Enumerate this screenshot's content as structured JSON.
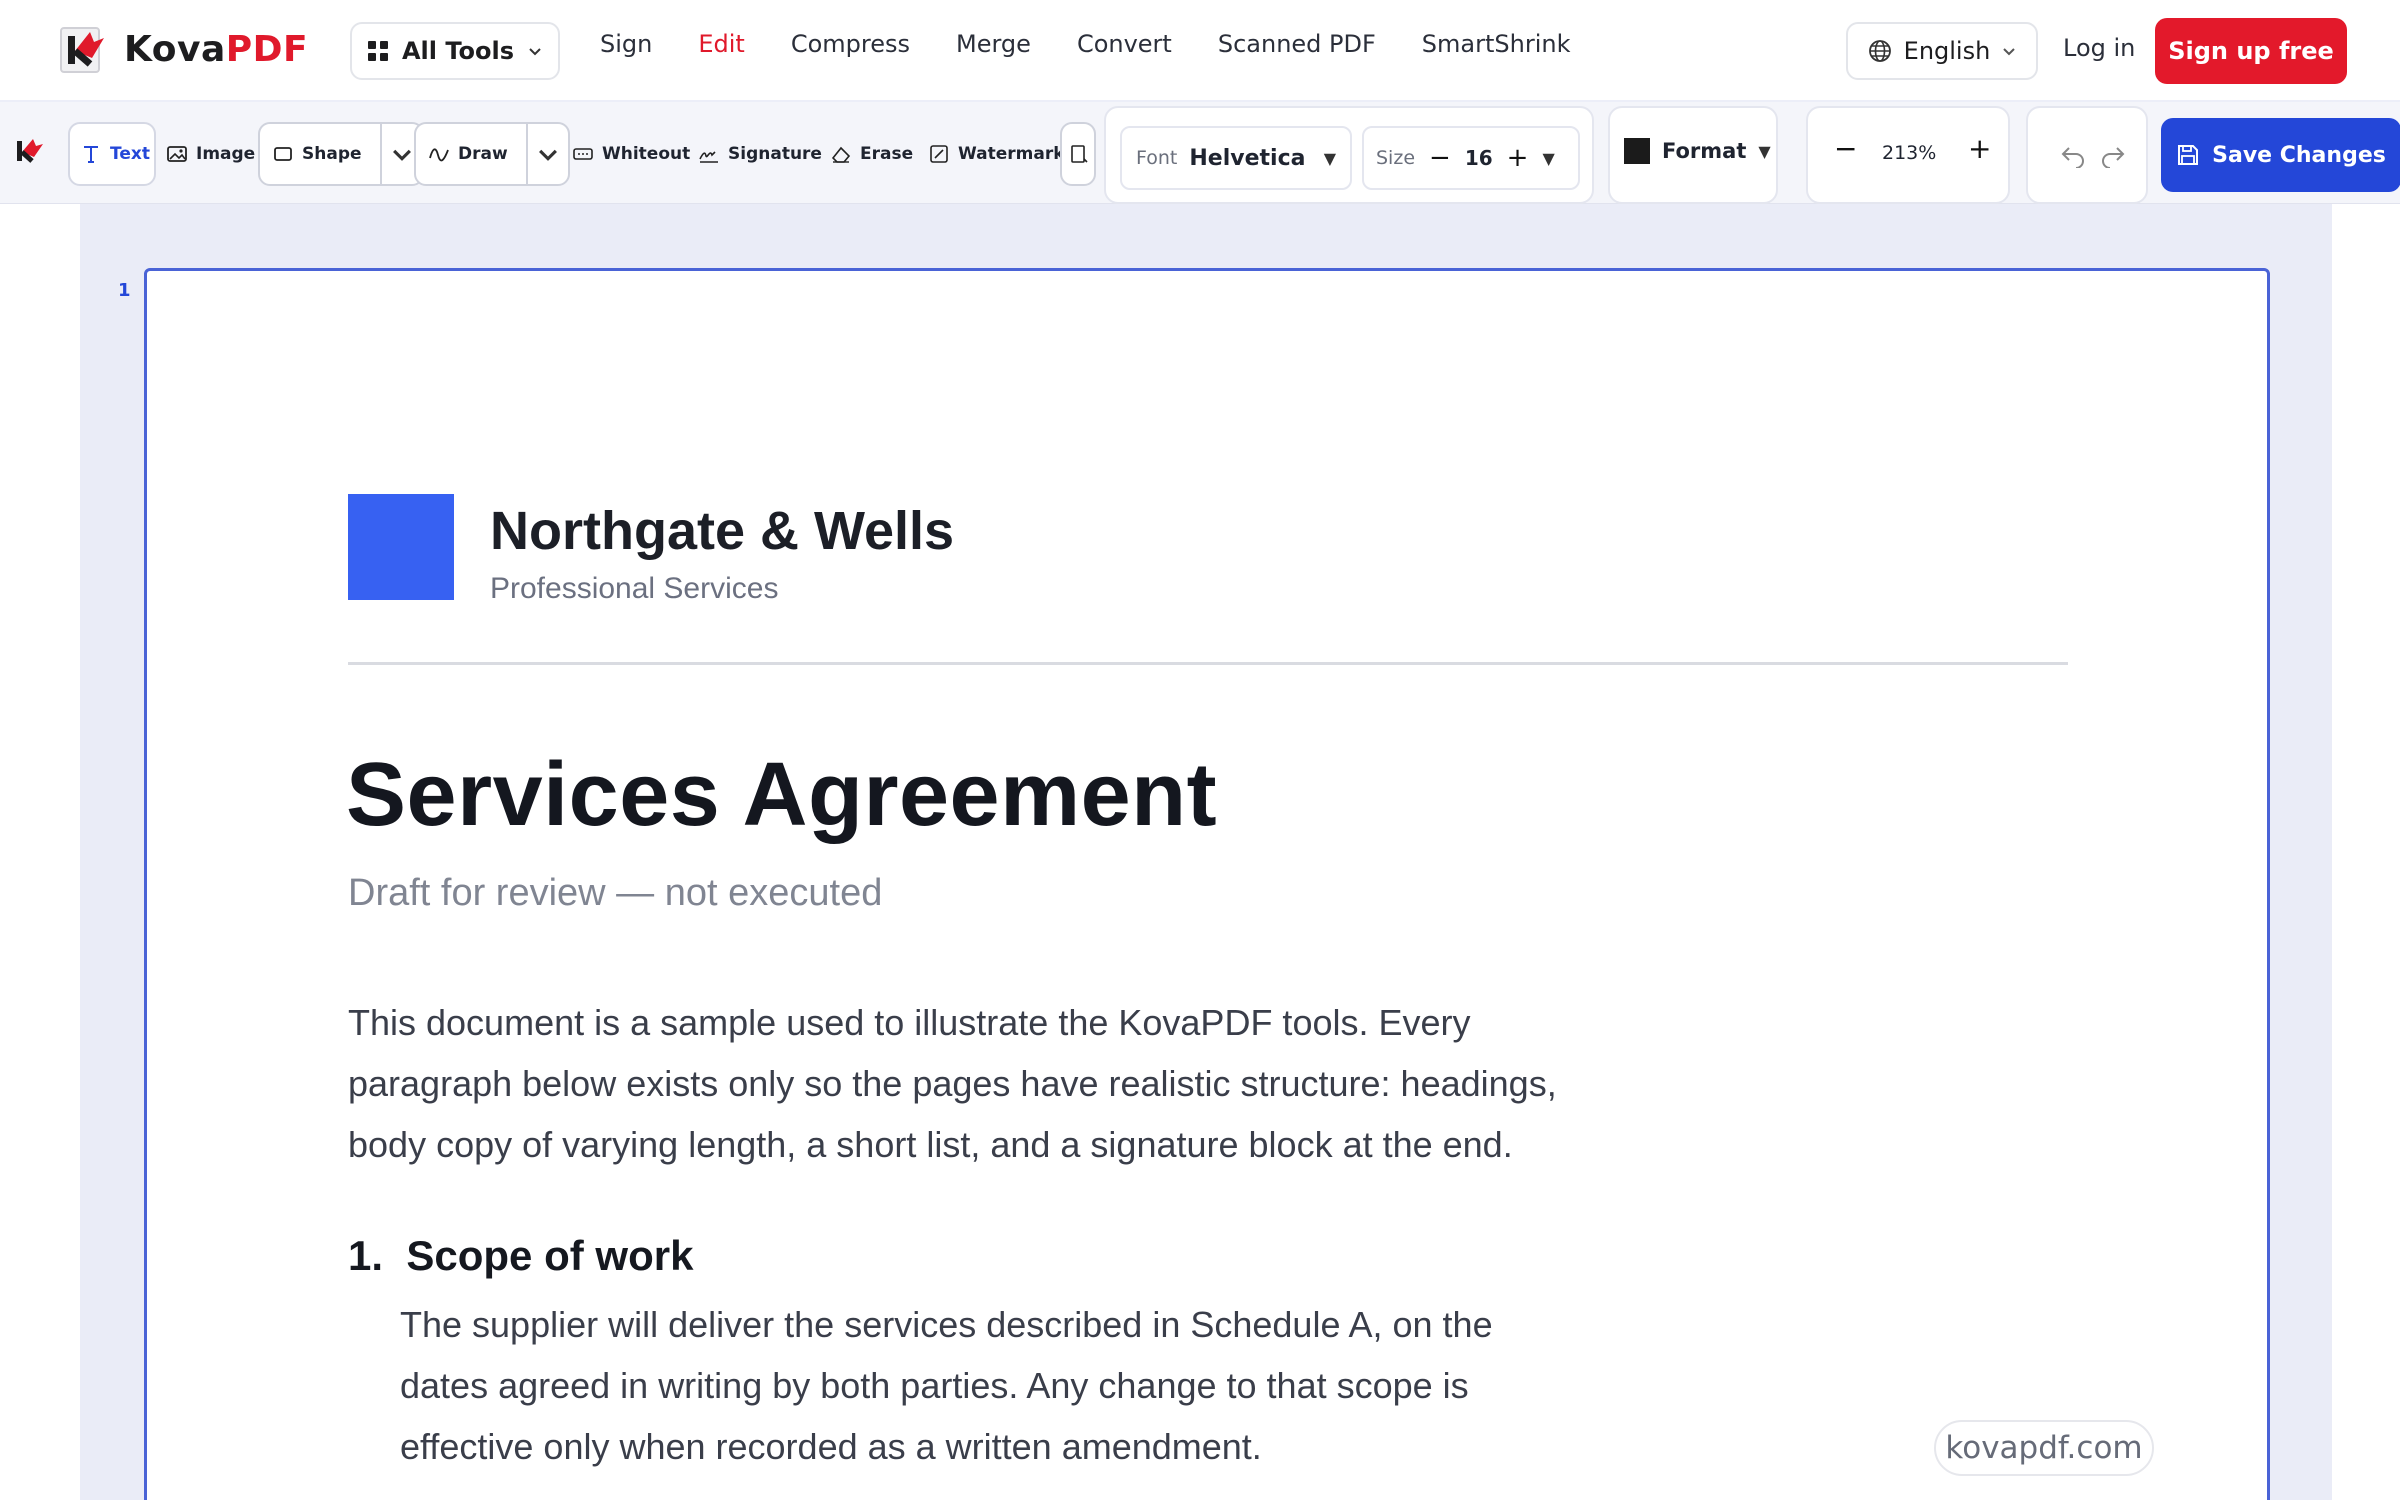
{
  "brand": {
    "name_a": "Kova",
    "name_b": "PDF",
    "accent": "#e0192b"
  },
  "nav": {
    "all_tools": "All Tools",
    "links": [
      "Sign",
      "Edit",
      "Compress",
      "Merge",
      "Convert",
      "Scanned PDF",
      "SmartShrink"
    ],
    "active": "Edit",
    "language": "English",
    "login": "Log in",
    "signup": "Sign up free"
  },
  "toolbar": {
    "tools": {
      "text": "Text",
      "image": "Image",
      "shape": "Shape",
      "draw": "Draw",
      "whiteout": "Whiteout",
      "signature": "Signature",
      "erase": "Erase",
      "watermark": "Watermark"
    },
    "font_label": "Font",
    "font_value": "Helvetica",
    "size_label": "Size",
    "size_value": "16",
    "format_label": "Format",
    "format_color": "#1b1b1b",
    "zoom": "213%",
    "save": "Save Changes",
    "primary_color": "#2447d8"
  },
  "document": {
    "page_number": "1",
    "company": "Northgate & Wells",
    "company_sub": "Professional Services",
    "title": "Services Agreement",
    "subtitle": "Draft for review — not executed",
    "intro_lines": [
      "This document is a sample used to illustrate the KovaPDF tools. Every",
      "paragraph below exists only so the pages have realistic structure: headings,",
      "body copy of varying length, a short list, and a signature block at the end."
    ],
    "section_number": "1.",
    "section_title": "Scope of work",
    "section_lines": [
      "The supplier will deliver the services described in Schedule A, on the",
      "dates agreed in writing by both parties. Any change to that scope is",
      "effective only when recorded as a written amendment."
    ],
    "logo_color": "#3761f2"
  },
  "watermark_text": "kovapdf.com"
}
